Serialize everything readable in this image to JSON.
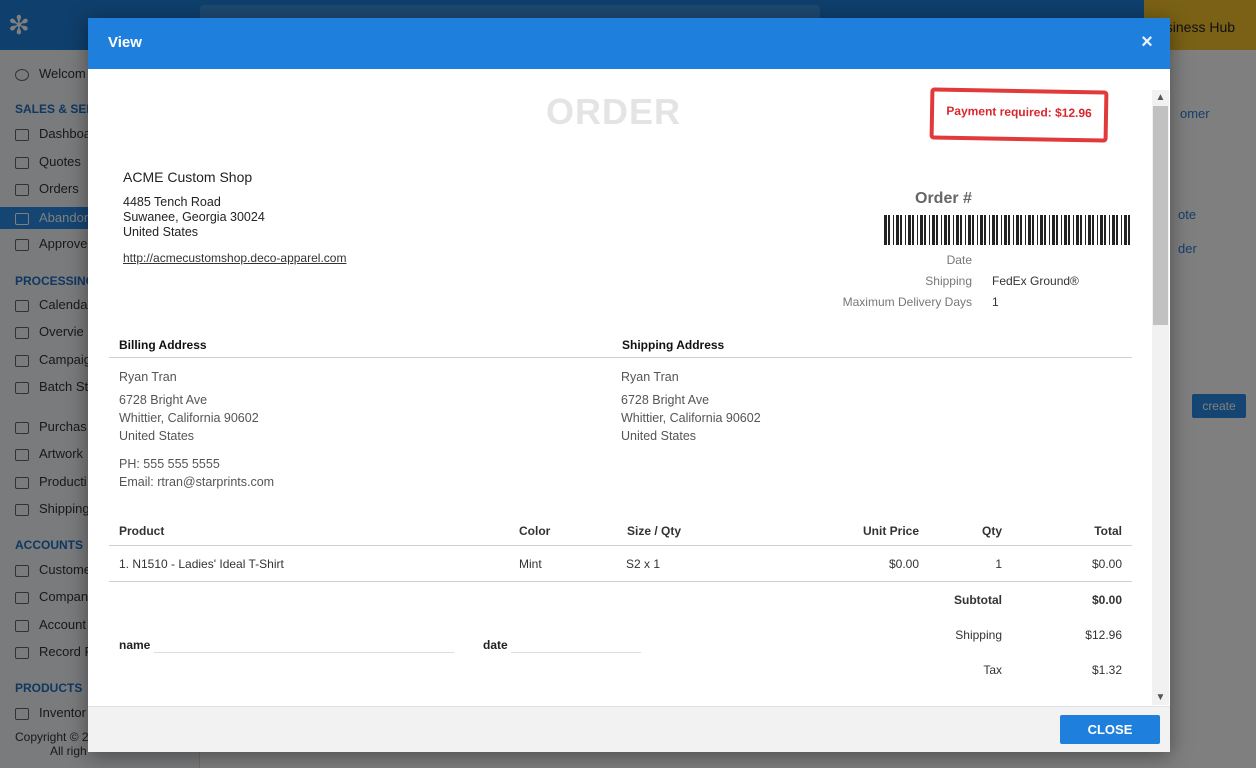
{
  "background": {
    "hub_label": "usiness Hub",
    "sidebar": {
      "welcome": "Welcom",
      "sections": [
        {
          "title": "SALES & SERV",
          "items": [
            "Dashboa",
            "Quotes",
            "Orders",
            "Abandon",
            "Approve"
          ]
        },
        {
          "title": "PROCESSING",
          "items": [
            "Calenda",
            "Overvie",
            "Campaig",
            "Batch St",
            "Purchas",
            "Artwork",
            "Producti",
            "Shipping"
          ]
        },
        {
          "title": "ACCOUNTS",
          "items": [
            "Custome",
            "Compan",
            "Account",
            "Record P"
          ]
        },
        {
          "title": "PRODUCTS",
          "items": [
            "Inventor"
          ]
        }
      ],
      "copyright_1": "Copyright © 2",
      "copyright_2": "All righ"
    },
    "right_links": [
      "omer",
      "ote",
      "der"
    ],
    "create_label": "create"
  },
  "modal": {
    "title": "View",
    "close_x": "×",
    "close_button": "CLOSE"
  },
  "order": {
    "doc_title": "ORDER",
    "stamp": "Payment required: $12.96",
    "shop": {
      "name": "ACME Custom Shop",
      "street": "4485 Tench Road",
      "city": "Suwanee, Georgia 30024",
      "country": "United States",
      "url": "http://acmecustomshop.deco-apparel.com"
    },
    "order_label": "Order #",
    "meta": {
      "date_label": "Date",
      "date_value": "",
      "shipping_label": "Shipping",
      "shipping_value": "FedEx Ground®",
      "max_days_label": "Maximum Delivery Days",
      "max_days_value": "1"
    },
    "billing": {
      "heading": "Billing Address",
      "name": "Ryan Tran",
      "street": "6728 Bright Ave",
      "city": "Whittier, California 90602",
      "country": "United States",
      "phone": "PH: 555 555 5555",
      "email": "Email: rtran@starprints.com"
    },
    "shipping_addr": {
      "heading": "Shipping Address",
      "name": "Ryan Tran",
      "street": "6728 Bright Ave",
      "city": "Whittier, California 90602",
      "country": "United States"
    },
    "table": {
      "headers": {
        "product": "Product",
        "color": "Color",
        "size_qty": "Size / Qty",
        "unit_price": "Unit Price",
        "qty": "Qty",
        "total": "Total"
      },
      "rows": [
        {
          "product": "1. N1510 - Ladies' Ideal T-Shirt",
          "color": "Mint",
          "size_qty": "S2 x 1",
          "unit_price": "$0.00",
          "qty": "1",
          "total": "$0.00"
        }
      ]
    },
    "totals": {
      "subtotal_label": "Subtotal",
      "subtotal": "$0.00",
      "shipping_label": "Shipping",
      "shipping": "$12.96",
      "tax_label": "Tax",
      "tax": "$1.32"
    },
    "signature": {
      "name_label": "name",
      "date_label": "date"
    }
  }
}
